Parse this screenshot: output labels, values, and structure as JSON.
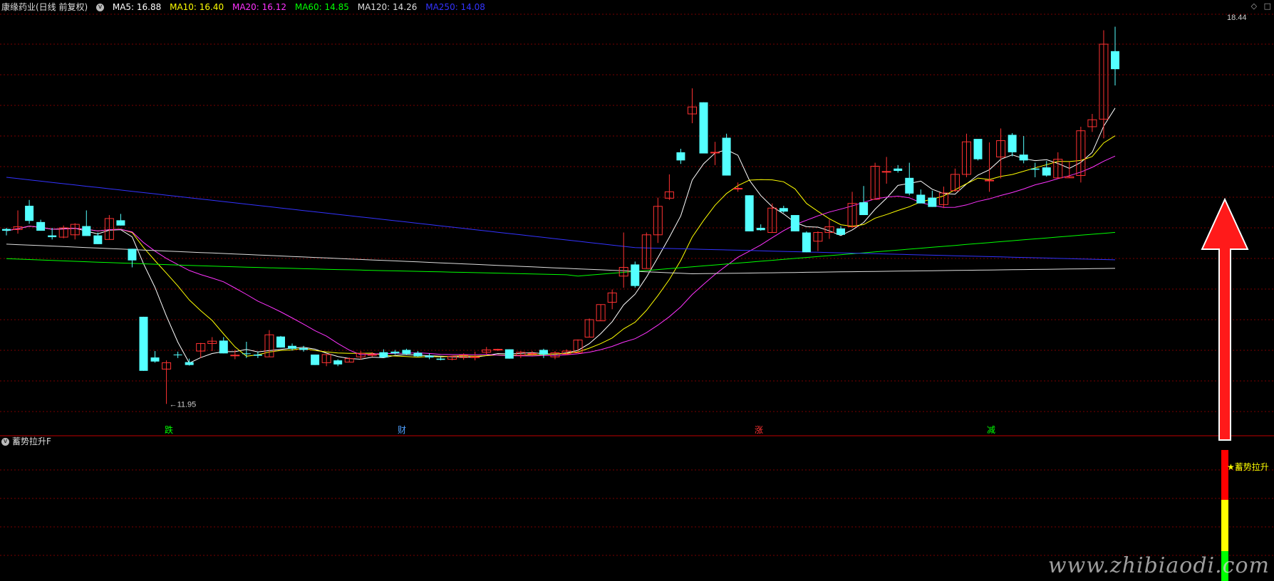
{
  "header": {
    "title": "康缘药业(日线 前复权)",
    "ma_items": [
      {
        "label": "MA5: 16.88",
        "color": "#ffffff"
      },
      {
        "label": "MA10: 16.40",
        "color": "#ffff00"
      },
      {
        "label": "MA20: 16.12",
        "color": "#ff33ff"
      },
      {
        "label": "MA60: 14.85",
        "color": "#00ff00"
      },
      {
        "label": "MA120: 14.26",
        "color": "#dddddd"
      },
      {
        "label": "MA250: 14.08",
        "color": "#3333ff"
      }
    ]
  },
  "window_buttons": [
    "◇",
    "□"
  ],
  "main_chart": {
    "high_label": "18.44",
    "low_label": "11.95",
    "event_markers": [
      {
        "text": "跌",
        "color": "#00ff00"
      },
      {
        "text": "财",
        "color": "#4fa0ff"
      },
      {
        "text": "涨",
        "color": "#ff3333"
      },
      {
        "text": "减",
        "color": "#00ff00"
      }
    ]
  },
  "sub_panel": {
    "title": "蓄势拉升F",
    "signal_label": "★蓄势拉升"
  },
  "watermark": "www.zhibiaodi.com",
  "colors": {
    "up": "#ff3232",
    "down": "#54ffff",
    "grid": "#7a0000",
    "panel_border": "#c00000",
    "ma5": "#ffffff",
    "ma10": "#ffff00",
    "ma20": "#ff33ff",
    "ma60": "#00ff00",
    "ma120": "#dddddd",
    "ma250": "#3333ff",
    "signal_yellow": "#ffff00",
    "signal_red": "#ff0000",
    "signal_green": "#00ff00"
  }
}
